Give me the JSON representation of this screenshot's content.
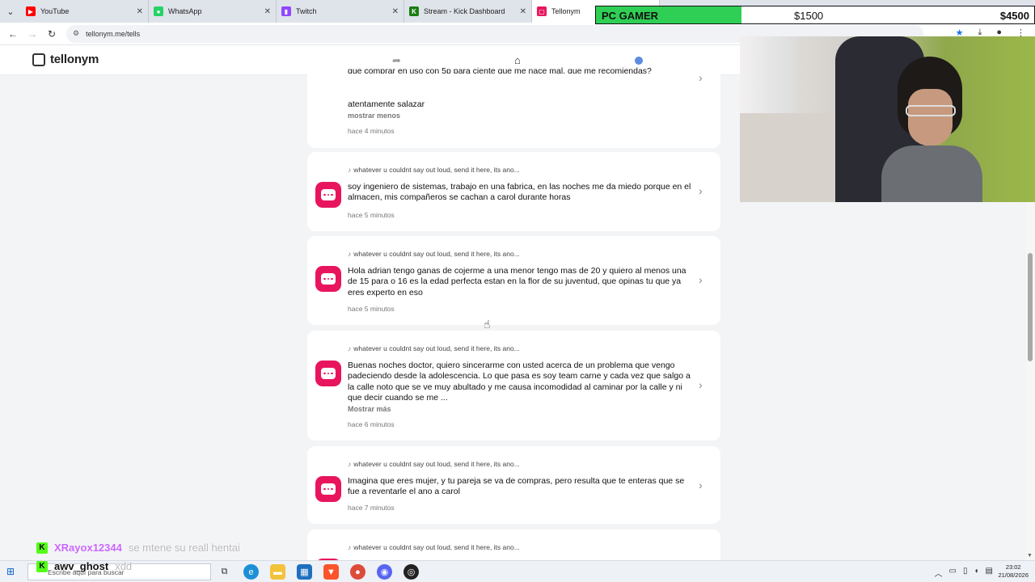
{
  "browser": {
    "tabs": [
      {
        "label": "YouTube",
        "icon": "youtube-icon",
        "color": "#ff0000"
      },
      {
        "label": "WhatsApp",
        "icon": "whatsapp-icon",
        "color": "#25d366"
      },
      {
        "label": "Twitch",
        "icon": "twitch-icon",
        "color": "#9146ff"
      },
      {
        "label": "Stream - Kick Dashboard",
        "icon": "kick-icon",
        "color": "#53fc18"
      },
      {
        "label": "Tellonym",
        "icon": "tellonym-icon",
        "color": "#e8155e"
      }
    ],
    "url": "tellonym.me/tells"
  },
  "header": {
    "logo_text": "tellonym"
  },
  "goal": {
    "title": "PC GAMER",
    "current": "$1500",
    "target": "$4500",
    "progress_fraction": 0.333
  },
  "feed": {
    "tag_text": "whatever u couldnt say out loud, send it here, its ano...",
    "cards": [
      {
        "body": "que comprar en uso con 5p para ciente que me nace mal, que me recomiendas?",
        "signature": "atentamente salazar",
        "more": "mostrar menos",
        "time": "hace 4 minutos"
      },
      {
        "body": "soy ingeniero de sistemas, trabajo en una fabrica, en las noches me da miedo porque en el almacen, mis compañeros se cachan a carol durante horas",
        "time": "hace 5 minutos"
      },
      {
        "body": "Hola adrian tengo ganas de cojerme a una menor tengo mas de 20 y quiero al menos una de 15 para o 16 es la edad perfecta estan en la flor de su juventud, que opinas tu que ya eres experto en eso",
        "time": "hace 5 minutos"
      },
      {
        "body": "Buenas noches doctor, quiero sincerarme con usted acerca de un problema que vengo padeciendo desde la adolescencia. Lo que pasa es soy team carne y cada vez que salgo a la calle noto que se ve muy abultado y me causa incomodidad al caminar por la calle y ni que decir cuando se me ...",
        "more": "Mostrar más",
        "time": "hace 6 minutos"
      },
      {
        "body": "Imagina que eres mujer, y tu pareja se va de compras, pero resulta que te enteras que se fue a reventarle el ano a carol",
        "time": "hace 7 minutos"
      }
    ]
  },
  "chat": [
    {
      "user": "XRayox12344",
      "user_color": "#c966ff",
      "message": "se mtene su reall hentai"
    },
    {
      "user": "awv_ghost",
      "user_color": "#111111",
      "message": "xdd"
    }
  ],
  "taskbar": {
    "search_placeholder": "Escribe aquí para buscar",
    "time": "23:02",
    "date": "21/08/2026"
  }
}
